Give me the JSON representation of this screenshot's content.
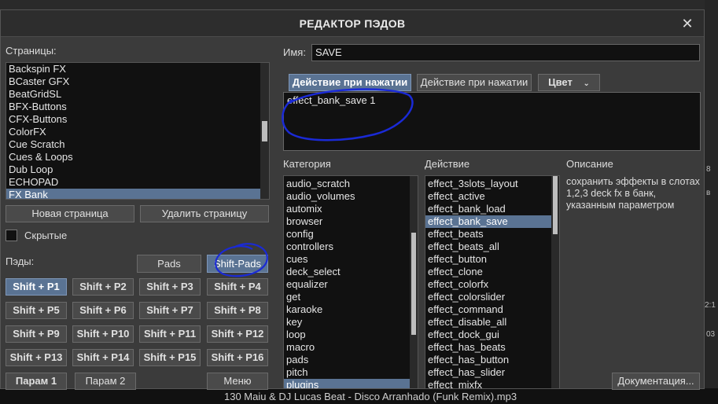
{
  "background": {
    "now_playing": "130  Maiu & DJ Lucas Beat - Disco Arranhado (Funk Remix).mp3",
    "side_labels": [
      "8",
      "в",
      "2:1",
      "03"
    ]
  },
  "dialog": {
    "title": "РЕДАКТОР ПЭДОВ",
    "close_glyph": "✕"
  },
  "pages": {
    "label": "Страницы:",
    "items": [
      "Backspin FX",
      "BCaster GFX",
      "BeatGridSL",
      "BFX-Buttons",
      "CFX-Buttons",
      "ColorFX",
      "Cue Scratch",
      "Cues & Loops",
      "Dub Loop",
      "ECHOPAD",
      "FX Bank"
    ],
    "selected": "FX Bank",
    "new_label": "Новая страница",
    "delete_label": "Удалить страницу",
    "hidden_label": "Скрытые",
    "hidden_checked": false
  },
  "pads": {
    "label": "Пэды:",
    "tab_pads": "Pads",
    "tab_shift": "Shift-Pads",
    "buttons": [
      "Shift + P1",
      "Shift + P2",
      "Shift + P3",
      "Shift + P4",
      "Shift + P5",
      "Shift + P6",
      "Shift + P7",
      "Shift + P8",
      "Shift + P9",
      "Shift + P10",
      "Shift + P11",
      "Shift + P12",
      "Shift + P13",
      "Shift + P14",
      "Shift + P15",
      "Shift + P16"
    ],
    "active": "Shift + P1",
    "param1": "Парам 1",
    "param2": "Парам 2",
    "menu": "Меню"
  },
  "editor": {
    "name_label": "Имя:",
    "name_value": "SAVE",
    "tab1": "Действие при нажатии",
    "tab2": "Действие при нажатии",
    "color_tab": "Цвет",
    "script": "effect_bank_save 1",
    "annotation_color": "#1a2ad6"
  },
  "category": {
    "label": "Категория",
    "items": [
      "audio_scratch",
      "audio_volumes",
      "automix",
      "browser",
      "config",
      "controllers",
      "cues",
      "deck_select",
      "equalizer",
      "get",
      "karaoke",
      "key",
      "loop",
      "macro",
      "pads",
      "pitch",
      "plugins"
    ],
    "selected": "plugins"
  },
  "action": {
    "label": "Действие",
    "items": [
      "effect_3slots_layout",
      "effect_active",
      "effect_bank_load",
      "effect_bank_save",
      "effect_beats",
      "effect_beats_all",
      "effect_button",
      "effect_clone",
      "effect_colorfx",
      "effect_colorslider",
      "effect_command",
      "effect_disable_all",
      "effect_dock_gui",
      "effect_has_beats",
      "effect_has_button",
      "effect_has_slider",
      "effect_mixfx"
    ],
    "selected": "effect_bank_save"
  },
  "description": {
    "label": "Описание",
    "text": "сохранить эффекты в слотах 1,2,3 deck fx в банк, указанным параметром",
    "docs_label": "Документация..."
  },
  "colors": {
    "accent": "#5a7393",
    "dialog_bg": "#3b3b3b",
    "list_bg": "#111111"
  }
}
